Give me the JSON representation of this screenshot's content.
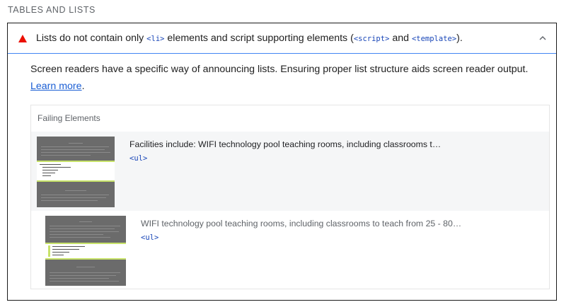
{
  "section": {
    "title": "TABLES AND LISTS"
  },
  "audit": {
    "title_pre": "Lists do not contain only ",
    "title_code1": "<li>",
    "title_mid": " elements and script supporting elements (",
    "title_code2": "<script>",
    "title_and": " and ",
    "title_code3": "<template>",
    "title_post": ").",
    "status_icon": "fail-triangle-icon",
    "status_color": "#eb0f00",
    "description_text": "Screen readers have a specific way of announcing lists. Ensuring proper list structure aids screen reader output. ",
    "learn_more_label": "Learn more",
    "description_end": ".",
    "expanded": true
  },
  "details": {
    "header": "Failing Elements",
    "items": [
      {
        "text": "Facilities include: WIFI technology pool teaching rooms, including classrooms t…",
        "code": "<ul>"
      },
      {
        "text": "WIFI technology pool teaching rooms, including classrooms to teach from 25 - 80…",
        "code": "<ul>"
      }
    ]
  },
  "colors": {
    "link": "#1a5ed4",
    "code": "#1a47b8",
    "highlight": "#c8e36a",
    "header_border": "#4285f4"
  }
}
